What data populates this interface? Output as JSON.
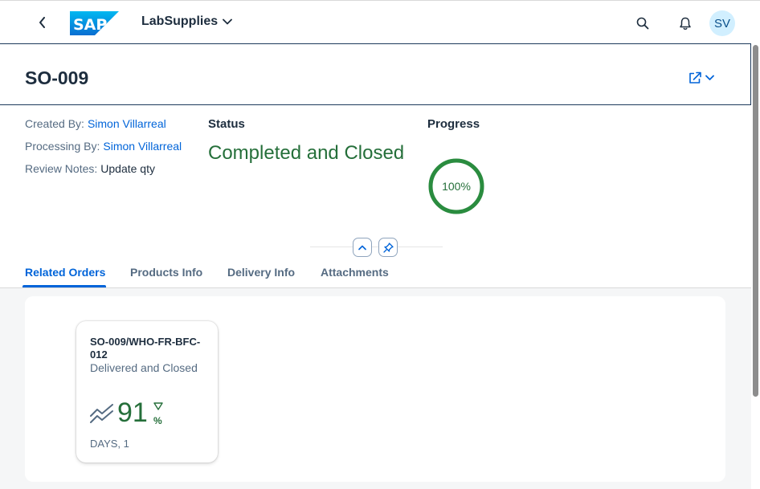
{
  "shell": {
    "logo_text": "SAP",
    "app_title": "LabSupplies",
    "avatar_initials": "SV",
    "icons": {
      "back": "chevron-left-icon",
      "title_menu": "chevron-down-icon",
      "search": "search-icon",
      "notifications": "bell-icon"
    }
  },
  "object": {
    "title": "SO-009",
    "actions_icon": "share-icon"
  },
  "attributes": [
    {
      "label": "Created By:",
      "value": "Simon Villarreal"
    },
    {
      "label": "Processing By:",
      "value": "Simon Villarreal"
    },
    {
      "label": "Review Notes:",
      "value": "Update qty"
    }
  ],
  "status": {
    "title": "Status",
    "value": "Completed and Closed",
    "color": "#256f3a"
  },
  "progress": {
    "title": "Progress",
    "label": "100%",
    "value": 1.0,
    "color": "#2a8c3f"
  },
  "tabs": [
    {
      "label": "Related Orders",
      "active": true
    },
    {
      "label": "Products Info",
      "active": false
    },
    {
      "label": "Delivery Info",
      "active": false
    },
    {
      "label": "Attachments",
      "active": false
    }
  ],
  "card": {
    "title": "SO-009/WHO-FR-BFC-012",
    "subtitle": "Delivered and Closed",
    "kpi_value": "91",
    "kpi_unit": "%",
    "kpi_trend": "down",
    "footer": "DAYS, 1",
    "trend_icon": "trend-line-icon"
  },
  "colors": {
    "accent": "#0064d9",
    "positive": "#256f3a",
    "text": "#1d2d3e",
    "muted": "#556b82"
  }
}
